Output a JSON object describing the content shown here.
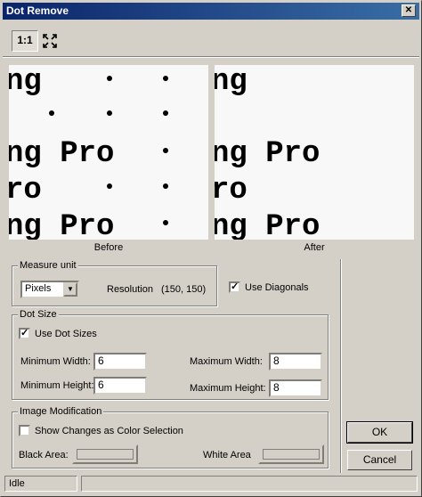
{
  "window": {
    "title": "Dot Remove",
    "close_glyph": "✕"
  },
  "toolbar": {
    "actual_size_label": "1:1",
    "fit_icon": "fit-to-window-icon"
  },
  "preview": {
    "before_label": "Before",
    "after_label": "After",
    "before_lines": [
      "ng",
      "",
      "ng Pro",
      "ro",
      "ng Pro"
    ],
    "after_lines": [
      "ng",
      "",
      "ng Pro",
      "ro",
      "ng Pro"
    ]
  },
  "measure_unit": {
    "group_title": "Measure unit",
    "unit_value": "Pixels",
    "resolution_label": "Resolution",
    "resolution_value": "(150, 150)",
    "use_diagonals_label": "Use Diagonals",
    "use_diagonals_checked": true
  },
  "dot_size": {
    "group_title": "Dot Size",
    "use_dot_sizes_label": "Use Dot Sizes",
    "use_dot_sizes_checked": true,
    "min_width_label": "Minimum Width:",
    "min_width_value": "6",
    "max_width_label": "Maximum Width:",
    "max_width_value": "8",
    "min_height_label": "Minimum Height:",
    "min_height_value": "6",
    "max_height_label": "Maximum Height:",
    "max_height_value": "8"
  },
  "image_modification": {
    "group_title": "Image Modification",
    "show_changes_label": "Show Changes as Color Selection",
    "show_changes_checked": false,
    "black_area_label": "Black Area:",
    "white_area_label": "White Area"
  },
  "buttons": {
    "ok": "OK",
    "cancel": "Cancel"
  },
  "status": {
    "text": "Idle",
    "secondary": ""
  }
}
